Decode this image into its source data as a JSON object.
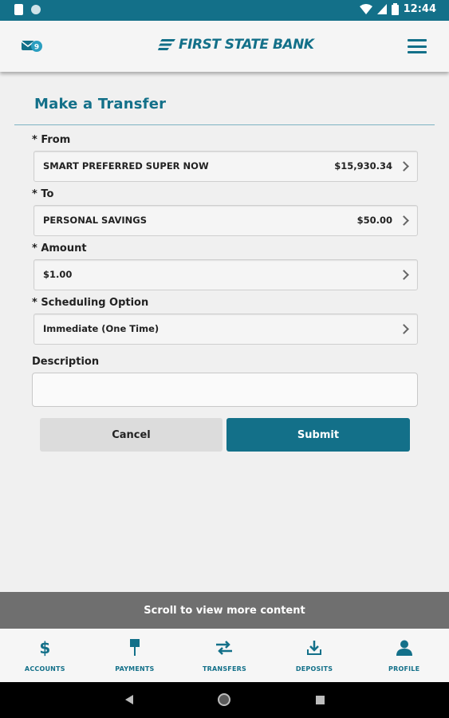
{
  "status_bar": {
    "time": "12:44"
  },
  "header": {
    "brand": "FIRST STATE BANK",
    "mail_badge": "9"
  },
  "page": {
    "title": "Make a Transfer"
  },
  "form": {
    "from": {
      "label": "* From",
      "account": "SMART PREFERRED SUPER NOW",
      "balance": "$15,930.34"
    },
    "to": {
      "label": "* To",
      "account": "PERSONAL SAVINGS",
      "balance": "$50.00"
    },
    "amount": {
      "label": "* Amount",
      "value": "$1.00"
    },
    "scheduling": {
      "label": "* Scheduling Option",
      "value": "Immediate (One Time)"
    },
    "description": {
      "label": "Description",
      "value": ""
    },
    "cancel_label": "Cancel",
    "submit_label": "Submit"
  },
  "scroll_hint": "Scroll to view more content",
  "bottom_nav": [
    {
      "label": "ACCOUNTS",
      "icon": "dollar-icon"
    },
    {
      "label": "PAYMENTS",
      "icon": "payments-icon"
    },
    {
      "label": "TRANSFERS",
      "icon": "transfer-arrows-icon"
    },
    {
      "label": "DEPOSITS",
      "icon": "download-icon"
    },
    {
      "label": "PROFILE",
      "icon": "person-icon"
    }
  ],
  "colors": {
    "brand": "#137089",
    "background": "#f0f0f0",
    "banner": "#6f6f6f"
  }
}
